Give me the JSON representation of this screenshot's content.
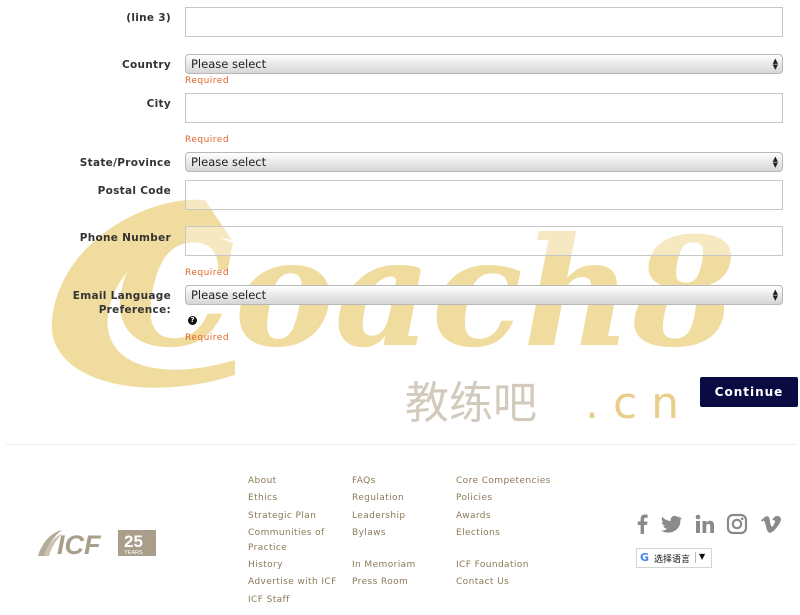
{
  "form": {
    "address_line3_label": "(line 3)",
    "country_label": "Country",
    "country_value": "Please select",
    "city_label": "City",
    "state_label": "State/Province",
    "state_value": "Please select",
    "postal_label": "Postal Code",
    "phone_label": "Phone Number",
    "email_lang_label_1": "Email Language",
    "email_lang_label_2": "Preference:",
    "email_lang_value": "Please select",
    "help_glyph": "?",
    "required_text": "Required",
    "continue_label": "Continue"
  },
  "watermark": {
    "main": "Coach8",
    "chinese": "教练吧",
    "suffix": ". c n"
  },
  "footer": {
    "col1": [
      "About",
      "Ethics",
      "Strategic Plan",
      "Communities of",
      "Practice",
      "History",
      "Advertise with ICF",
      "ICF Staff"
    ],
    "col2": [
      "FAQs",
      "Regulation",
      "Leadership",
      "Bylaws",
      "In Memoriam",
      "Press Room"
    ],
    "col3": [
      "Core Competencies",
      "Policies",
      "Awards",
      "Elections",
      "ICF Foundation",
      "Contact Us"
    ],
    "logo_text": "ICF",
    "logo_number": "25",
    "logo_years": "YEARS",
    "translate_g": "G",
    "translate_label": "选择语言",
    "translate_arrow": "▼",
    "social_icons": [
      "facebook-icon",
      "twitter-icon",
      "linkedin-icon",
      "instagram-icon",
      "vimeo-icon"
    ]
  },
  "colors": {
    "required": "#e2632a",
    "button": "#0b0b44",
    "footer_link": "#8a7a57",
    "watermark": "#f1dc9f"
  }
}
